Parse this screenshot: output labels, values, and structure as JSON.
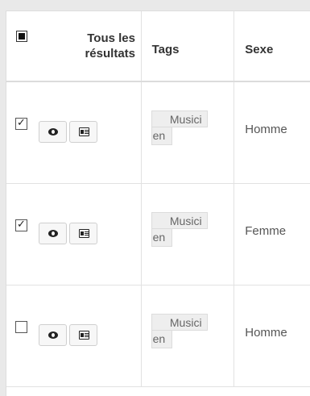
{
  "table": {
    "header": {
      "select_all_label": "Tous les résultats",
      "tags_label": "Tags",
      "sexe_label": "Sexe"
    },
    "rows": [
      {
        "checked": true,
        "tag_line1": "Musici",
        "tag_line2": "en",
        "sexe": "Homme"
      },
      {
        "checked": true,
        "tag_line1": "Musici",
        "tag_line2": "en",
        "sexe": "Femme"
      },
      {
        "checked": false,
        "tag_line1": "Musici",
        "tag_line2": "en",
        "sexe": "Homme"
      }
    ],
    "row_buttons": {
      "view_icon": "eye-icon",
      "card_icon": "id-card-icon"
    },
    "header_checkbox_state": "indeterminate"
  }
}
